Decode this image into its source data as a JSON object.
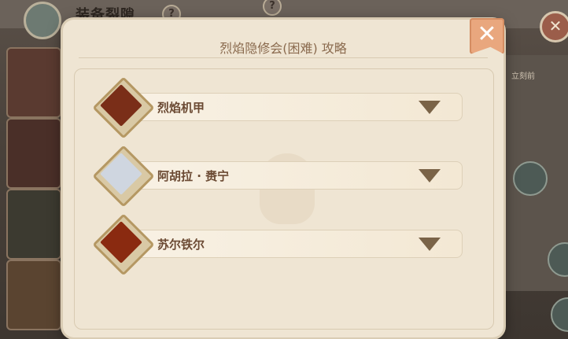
{
  "background": {
    "title": "装备裂隙",
    "help_glyph": "?",
    "close_glyph": "✕",
    "side_text": "立刻前"
  },
  "dialog": {
    "title": "烈焰隐修会(困难) 攻略",
    "close_glyph": "✕"
  },
  "bosses": [
    {
      "name": "烈焰机甲",
      "color": "#7a2e18"
    },
    {
      "name": "阿胡拉 · 赉宁",
      "color": "#cfd6e0"
    },
    {
      "name": "苏尔铁尔",
      "color": "#8a2a10"
    }
  ]
}
